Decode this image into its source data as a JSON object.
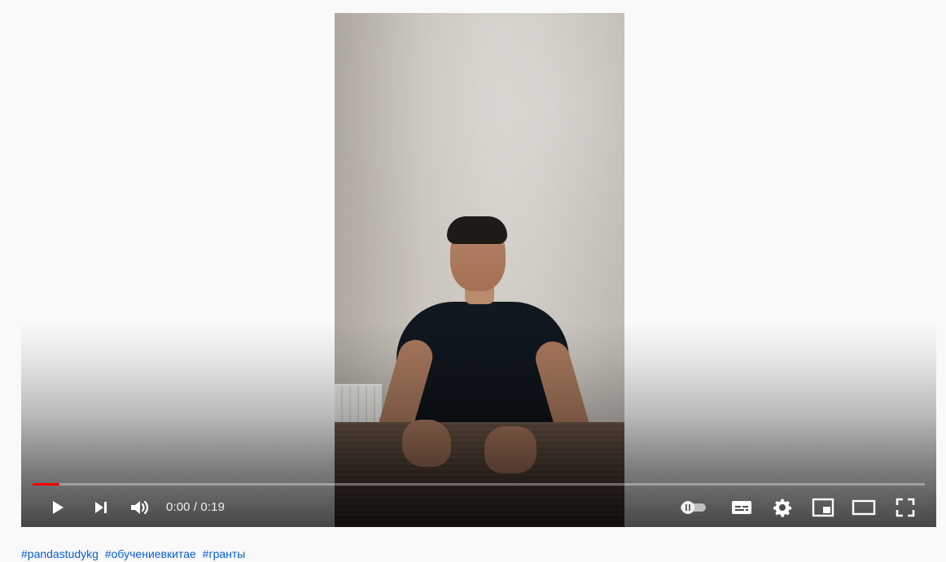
{
  "player": {
    "time_current": "0:00",
    "time_separator": " / ",
    "time_total": "0:19",
    "progress_fraction": 0.03
  },
  "controls": {
    "play": "play-icon",
    "next": "next-icon",
    "volume": "volume-icon",
    "autoplay": "autoplay-toggle-icon",
    "subtitles": "subtitles-icon",
    "settings": "gear-icon",
    "miniplayer": "miniplayer-icon",
    "theater": "theater-mode-icon",
    "fullscreen": "fullscreen-icon"
  },
  "hashtags": [
    "#pandastudykg",
    "#обучениевкитае",
    "#гранты"
  ],
  "colors": {
    "progress": "#ff0000",
    "link": "#065fd4",
    "page_background": "#f9f9f9"
  }
}
